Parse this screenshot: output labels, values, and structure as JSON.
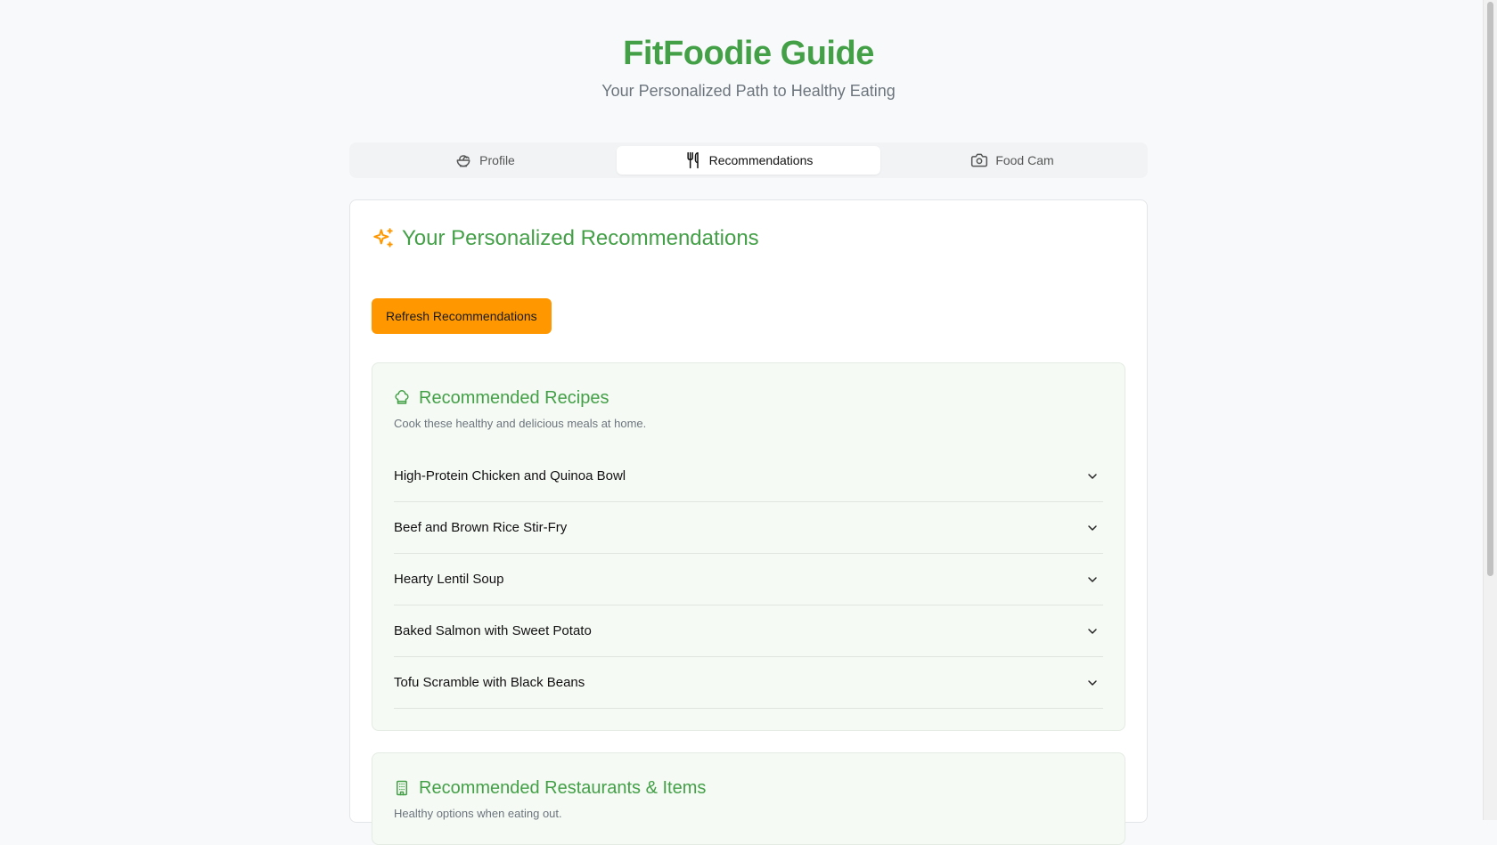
{
  "header": {
    "title": "FitFoodie Guide",
    "subtitle": "Your Personalized Path to Healthy Eating"
  },
  "tabs": [
    {
      "label": "Profile",
      "icon": "salad-bowl-icon",
      "active": false
    },
    {
      "label": "Recommendations",
      "icon": "utensils-icon",
      "active": true
    },
    {
      "label": "Food Cam",
      "icon": "camera-icon",
      "active": false
    }
  ],
  "recommendations": {
    "title": "Your Personalized Recommendations",
    "icon": "sparkles-icon",
    "refresh_label": "Refresh Recommendations",
    "recipes": {
      "title": "Recommended Recipes",
      "icon": "chef-hat-icon",
      "description": "Cook these healthy and delicious meals at home.",
      "items": [
        "High-Protein Chicken and Quinoa Bowl",
        "Beef and Brown Rice Stir-Fry",
        "Hearty Lentil Soup",
        "Baked Salmon with Sweet Potato",
        "Tofu Scramble with Black Beans"
      ]
    },
    "restaurants": {
      "title": "Recommended Restaurants & Items",
      "icon": "building-icon",
      "description": "Healthy options when eating out."
    }
  },
  "colors": {
    "brand_green": "#43a047",
    "accent_orange": "#ff9800",
    "background": "#f8f9fa"
  }
}
